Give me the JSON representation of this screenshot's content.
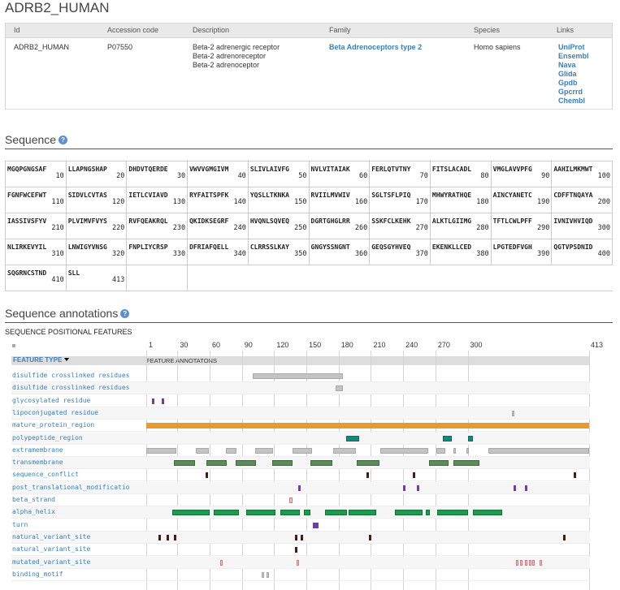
{
  "title": "ADRB2_HUMAN",
  "info": {
    "headers": [
      "Id",
      "Accession code",
      "Description",
      "Family",
      "Species",
      "Links"
    ],
    "id": "ADRB2_HUMAN",
    "accession": "P07550",
    "description": [
      "Beta-2 adrenergic receptor",
      "Beta-2 adrenoreceptor",
      "Beta-2 adrenoceptor"
    ],
    "family": "Beta Adrenoceptors type 2",
    "species": "Homo sapiens",
    "links": [
      "UniProt",
      "Ensembl",
      "Nava",
      "Glida",
      "Gpdb",
      "Gpcrrd",
      "Chembl"
    ]
  },
  "sequence_title": "Sequence",
  "help_glyph": "?",
  "sequence": [
    [
      [
        "MGQPGNGSAF",
        "10"
      ],
      [
        "LLAPNGSHAP",
        "20"
      ],
      [
        "DHDVTQERDE",
        "30"
      ],
      [
        "VWVVGMGIVM",
        "40"
      ],
      [
        "SLIVLAIVFG",
        "50"
      ],
      [
        "NVLVITAIAK",
        "60"
      ],
      [
        "FERLQTVTNY",
        "70"
      ],
      [
        "FITSLACADL",
        "80"
      ],
      [
        "VMGLAVVPFG",
        "90"
      ],
      [
        "AAHILMKMWT",
        "100"
      ]
    ],
    [
      [
        "FGNFWCEFWT",
        "110"
      ],
      [
        "SIDVLCVTAS",
        "120"
      ],
      [
        "IETLCVIAVD",
        "130"
      ],
      [
        "RYFAITSPFK",
        "140"
      ],
      [
        "YQSLLTKNKA",
        "150"
      ],
      [
        "RVIILMVWIV",
        "160"
      ],
      [
        "SGLTSFLPIQ",
        "170"
      ],
      [
        "MHWYRATHQE",
        "180"
      ],
      [
        "AINCYANETC",
        "190"
      ],
      [
        "CDFFTNQAYA",
        "200"
      ]
    ],
    [
      [
        "IASSIVSFYV",
        "210"
      ],
      [
        "PLVIMVFVYS",
        "220"
      ],
      [
        "RVFQEAKRQL",
        "230"
      ],
      [
        "QKIDKSEGRF",
        "240"
      ],
      [
        "HVQNLSQVEQ",
        "250"
      ],
      [
        "DGRTGHGLRR",
        "260"
      ],
      [
        "SSKFCLKEHK",
        "270"
      ],
      [
        "ALKTLGIIMG",
        "280"
      ],
      [
        "TFTLCWLPFF",
        "290"
      ],
      [
        "IVNIVHVIQD",
        "300"
      ]
    ],
    [
      [
        "NLIRKEVYIL",
        "310"
      ],
      [
        "LNWIGYVNSG",
        "320"
      ],
      [
        "FNPLIYCRSP",
        "330"
      ],
      [
        "DFRIAFQELL",
        "340"
      ],
      [
        "CLRRSSLKAY",
        "350"
      ],
      [
        "GNGYSSNGNT",
        "360"
      ],
      [
        "GEQSGYHVEQ",
        "370"
      ],
      [
        "EKENKLLCED",
        "380"
      ],
      [
        "LPGTEDFVGH",
        "390"
      ],
      [
        "QGTVPSDNID",
        "400"
      ]
    ],
    [
      [
        "SQGRNCSTND",
        "410"
      ],
      [
        "SLL",
        "413"
      ]
    ]
  ],
  "annotations_title": "Sequence annotations",
  "positional_title": "SEQUENCE POSITIONAL FEATURES",
  "viewer": {
    "axis_ticks": [
      "1",
      "30",
      "60",
      "90",
      "120",
      "150",
      "180",
      "210",
      "240",
      "270",
      "300",
      "413"
    ],
    "feature_type_label": "FEATURE TYPE",
    "feature_annotations_label": "FEATURE ANNOTATONS",
    "length": 413,
    "colors": {
      "gray": "#c3c3c3",
      "orange": "#e79a2e",
      "teal": "#16887a",
      "green": "#5e8a5e",
      "alpha": "#1f9a4a",
      "dark": "#4a1a1a",
      "purple": "#6a3fa8",
      "pink": "#e8a0a0",
      "conj": "#bbbbbb"
    },
    "rows": [
      {
        "label": "disulfide crosslinked residues",
        "segs": [
          [
            100,
            184,
            "gray"
          ]
        ]
      },
      {
        "label": "disulfide crosslinked residues",
        "segs": [
          [
            177,
            184,
            "gray"
          ]
        ]
      },
      {
        "label": "glycosylated residue",
        "segs": [
          [
            6,
            7,
            "purple"
          ],
          [
            15,
            16,
            "purple"
          ]
        ]
      },
      {
        "label": "lipoconjugated residue",
        "segs": [
          [
            341,
            342,
            "conj"
          ]
        ]
      },
      {
        "label": "mature_protein_region",
        "segs": [
          [
            1,
            413,
            "orange"
          ]
        ]
      },
      {
        "label": "polypeptide_region",
        "segs": [
          [
            187,
            199,
            "teal"
          ],
          [
            277,
            285,
            "teal"
          ],
          [
            300,
            305,
            "teal"
          ]
        ]
      },
      {
        "label": "extramembrane",
        "segs": [
          [
            1,
            29,
            "gray"
          ],
          [
            47,
            59,
            "gray"
          ],
          [
            75,
            85,
            "gray"
          ],
          [
            102,
            119,
            "gray"
          ],
          [
            137,
            155,
            "gray"
          ],
          [
            175,
            196,
            "gray"
          ],
          [
            219,
            263,
            "gray"
          ],
          [
            271,
            279,
            "gray"
          ],
          [
            287,
            288,
            "gray"
          ],
          [
            299,
            300,
            "gray"
          ],
          [
            319,
            413,
            "gray"
          ]
        ]
      },
      {
        "label": "transmembrane",
        "segs": [
          [
            27,
            46,
            "green"
          ],
          [
            57,
            76,
            "green"
          ],
          [
            84,
            103,
            "green"
          ],
          [
            118,
            137,
            "green"
          ],
          [
            154,
            174,
            "green"
          ],
          [
            197,
            218,
            "green"
          ],
          [
            264,
            282,
            "green"
          ],
          [
            287,
            311,
            "green"
          ]
        ]
      },
      {
        "label": "sequence_conflict",
        "segs": [
          [
            56,
            57,
            "dark"
          ],
          [
            206,
            207,
            "dark"
          ],
          [
            249,
            250,
            "dark"
          ],
          [
            399,
            400,
            "dark"
          ]
        ]
      },
      {
        "label": "post_translational_modificatio",
        "segs": [
          [
            142,
            143,
            "purple"
          ],
          [
            240,
            241,
            "purple"
          ],
          [
            253,
            254,
            "purple"
          ],
          [
            343,
            344,
            "purple"
          ],
          [
            353,
            354,
            "purple"
          ]
        ]
      },
      {
        "label": "beta_strand",
        "segs": [
          [
            134,
            137,
            "pink"
          ]
        ]
      },
      {
        "label": "alpha_helix",
        "segs": [
          [
            25,
            60,
            "alpha"
          ],
          [
            64,
            87,
            "alpha"
          ],
          [
            94,
            121,
            "alpha"
          ],
          [
            126,
            144,
            "alpha"
          ],
          [
            148,
            154,
            "alpha"
          ],
          [
            167,
            188,
            "alpha"
          ],
          [
            189,
            215,
            "alpha"
          ],
          [
            232,
            258,
            "alpha"
          ],
          [
            261,
            265,
            "alpha"
          ],
          [
            272,
            300,
            "alpha"
          ],
          [
            305,
            332,
            "alpha"
          ]
        ]
      },
      {
        "label": "turn",
        "segs": [
          [
            156,
            161,
            "purple"
          ]
        ]
      },
      {
        "label": "natural_variant_site",
        "segs": [
          [
            12,
            13,
            "dark"
          ],
          [
            20,
            21,
            "dark"
          ],
          [
            27,
            28,
            "dark"
          ],
          [
            139,
            140,
            "dark"
          ],
          [
            145,
            146,
            "dark"
          ],
          [
            208,
            209,
            "dark"
          ],
          [
            389,
            390,
            "dark"
          ]
        ]
      },
      {
        "label": "natural_variant_site",
        "segs": [
          [
            139,
            140,
            "dark"
          ]
        ]
      },
      {
        "label": "mutated_variant_site",
        "segs": [
          [
            70,
            71,
            "pink"
          ],
          [
            141,
            142,
            "pink"
          ],
          [
            345,
            346,
            "pink"
          ],
          [
            349,
            350,
            "pink"
          ],
          [
            353,
            354,
            "pink"
          ],
          [
            357,
            358,
            "pink"
          ],
          [
            360,
            361,
            "pink"
          ],
          [
            367,
            368,
            "pink"
          ]
        ]
      },
      {
        "label": "binding_motif",
        "segs": [
          [
            108,
            109,
            "gray"
          ],
          [
            113,
            114,
            "gray"
          ]
        ]
      }
    ]
  }
}
